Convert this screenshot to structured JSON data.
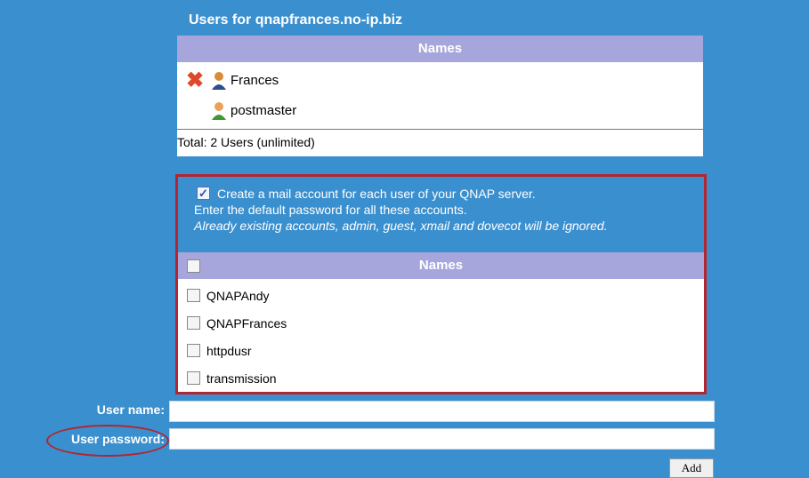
{
  "title": "Users for qnapfrances.no-ip.biz",
  "users_panel": {
    "header": "Names",
    "users": [
      {
        "name": "Frances",
        "deletable": true,
        "avatar_icon": "user-orange-icon"
      },
      {
        "name": "postmaster",
        "deletable": false,
        "avatar_icon": "user-green-icon"
      }
    ],
    "total": "Total: 2 Users (unlimited)"
  },
  "mail_accounts": {
    "create_checked": true,
    "line1": "Create a mail account for each user of your QNAP server.",
    "line2": "Enter the default password for all these accounts.",
    "line3": "Already existing accounts, admin, guest, xmail and dovecot will be ignored.",
    "header": "Names",
    "accounts": [
      "QNAPAndy",
      "QNAPFrances",
      "httpdusr",
      "transmission"
    ]
  },
  "form": {
    "username_label": "User name:",
    "password_label": "User password:",
    "username_value": "",
    "password_value": "",
    "add_label": "Add"
  },
  "colors": {
    "background": "#3a8fcf",
    "header": "#a7a6dc",
    "highlight": "#b3252f"
  }
}
